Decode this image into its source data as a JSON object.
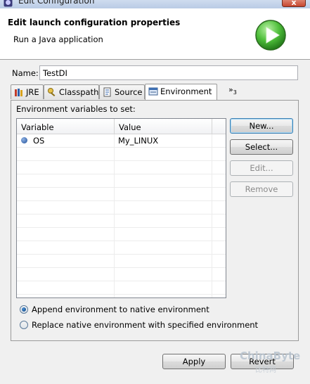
{
  "window": {
    "title": "Edit Configuration",
    "close_label": "x"
  },
  "header": {
    "title": "Edit launch configuration properties",
    "subtitle": "Run a Java application",
    "icon": "run-play-icon"
  },
  "name_field": {
    "label": "Name:",
    "value": "TestDI"
  },
  "tabs": [
    {
      "label": "JRE",
      "icon": "jre-books-icon"
    },
    {
      "label": "Classpath",
      "icon": "classpath-icon"
    },
    {
      "label": "Source",
      "icon": "source-icon"
    },
    {
      "label": "Environment",
      "icon": "environment-icon",
      "active": true
    }
  ],
  "more_tabs": {
    "label": "»",
    "count": "3"
  },
  "environment": {
    "label": "Environment variables to set:",
    "columns": [
      "Variable",
      "Value"
    ],
    "rows": [
      {
        "variable": "OS",
        "value": "My_LINUX"
      }
    ]
  },
  "buttons": {
    "new": "New...",
    "select": "Select...",
    "edit": "Edit...",
    "remove": "Remove"
  },
  "radios": {
    "append": "Append environment to native environment",
    "replace": "Replace native environment with specified environment",
    "selected": "append"
  },
  "footer": {
    "apply": "Apply",
    "revert": "Revert"
  },
  "watermark": {
    "brand": "ChinaByte",
    "sub": "比特网"
  }
}
